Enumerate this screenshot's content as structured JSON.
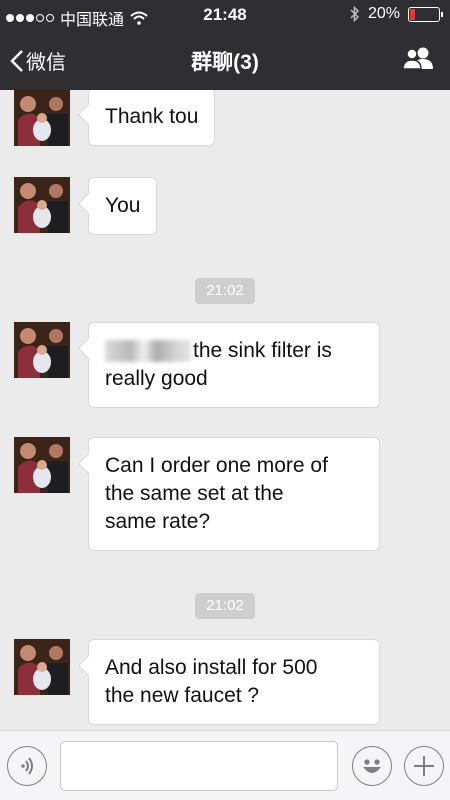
{
  "status_bar": {
    "carrier": "中国联通",
    "time": "21:48",
    "battery": "20%",
    "battery_level": 0.2,
    "signal_bars_filled": 3,
    "signal_bars_total": 5
  },
  "nav": {
    "back_label": "微信",
    "title": "群聊(3)"
  },
  "messages": [
    {
      "text": "Thank tou"
    },
    {
      "text": "You"
    },
    {
      "timestamp": "21:02"
    },
    {
      "text_suffix": "the sink filter is",
      "text_line2": "really good"
    },
    {
      "line1": "Can I order one more of",
      "line2": "the same set at the",
      "line3": "same rate?"
    },
    {
      "timestamp": "21:02"
    },
    {
      "line1": "And also install for 500",
      "line2": "the new faucet ?"
    }
  ],
  "input": {
    "placeholder": "",
    "value": ""
  },
  "colors": {
    "header": "#2e2e33",
    "background": "#ebebeb",
    "bubble": "#ffffff",
    "battery_low": "#e53935"
  }
}
